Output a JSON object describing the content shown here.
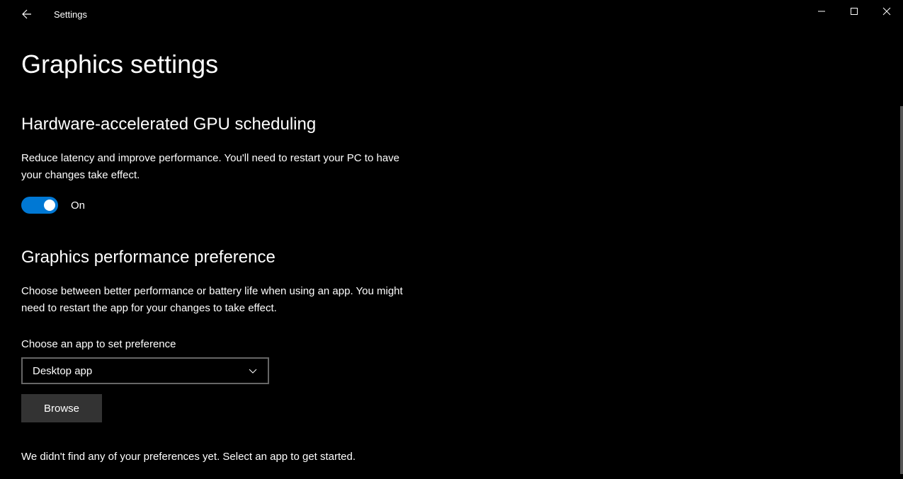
{
  "window": {
    "title": "Settings"
  },
  "page": {
    "title": "Graphics settings"
  },
  "gpu_scheduling": {
    "heading": "Hardware-accelerated GPU scheduling",
    "description": "Reduce latency and improve performance. You'll need to restart your PC to have your changes take effect.",
    "toggle_state": "On"
  },
  "performance_preference": {
    "heading": "Graphics performance preference",
    "description": "Choose between better performance or battery life when using an app. You might need to restart the app for your changes to take effect.",
    "choose_app_label": "Choose an app to set preference",
    "dropdown_selected": "Desktop app",
    "browse_label": "Browse",
    "empty_message": "We didn't find any of your preferences yet. Select an app to get started."
  },
  "colors": {
    "accent": "#0078d4",
    "background": "#000000",
    "button_bg": "#333333"
  }
}
